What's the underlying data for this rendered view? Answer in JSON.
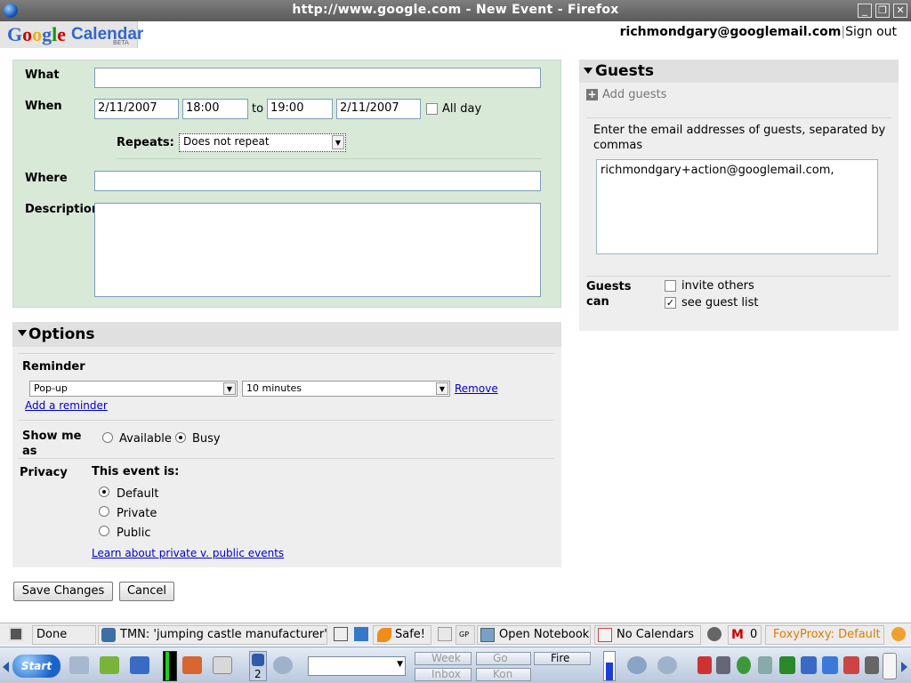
{
  "window": {
    "title": "http://www.google.com - New Event - Firefox"
  },
  "header": {
    "logo_google": "Google",
    "logo_calendar": "Calendar",
    "logo_beta": "BETA",
    "user_email": "richmondgary@googlemail.com",
    "separator": "|",
    "sign_out": "Sign out"
  },
  "event": {
    "what_label": "What",
    "what_value": "",
    "when_label": "When",
    "start_date": "2/11/2007",
    "start_time": "18:00",
    "to_label": "to",
    "end_time": "19:00",
    "end_date": "2/11/2007",
    "all_day_label": "All day",
    "repeats_label": "Repeats:",
    "repeats_value": "Does not repeat",
    "where_label": "Where",
    "where_value": "",
    "description_label": "Description",
    "description_value": ""
  },
  "options": {
    "title": "Options",
    "reminder_label": "Reminder",
    "reminder_type": "Pop-up",
    "reminder_time": "10 minutes",
    "remove_link": "Remove",
    "add_reminder_link": "Add a reminder",
    "show_me_as_label_1": "Show me",
    "show_me_as_label_2": "as",
    "available_label": "Available",
    "busy_label": "Busy",
    "privacy_label": "Privacy",
    "this_event_is": "This event is:",
    "privacy_default": "Default",
    "privacy_private": "Private",
    "privacy_public": "Public",
    "privacy_link": "Learn about private v. public events"
  },
  "guests": {
    "title": "Guests",
    "add_guests": "Add guests",
    "instructions": "Enter the email addresses of guests, separated by commas",
    "emails_value": "richmondgary+action@googlemail.com,",
    "guests_can_1": "Guests",
    "guests_can_2": "can",
    "invite_others": "invite others",
    "see_guest_list": "see guest list"
  },
  "buttons": {
    "save": "Save Changes",
    "cancel": "Cancel"
  },
  "statusbar": {
    "done": "Done",
    "tmn": "TMN: 'jumping castle manufacturer'",
    "safe": "Safe!",
    "gp": "GP",
    "open_notebook": "Open Notebook",
    "no_calendars": "No Calendars",
    "mail_count": "0",
    "foxyproxy": "FoxyProxy: Default"
  },
  "taskbar": {
    "start": "Start",
    "desktop_num": "2",
    "task_week": "Week",
    "task_go": "Go",
    "task_fire": "Fire",
    "task_inbox": "Inbox",
    "task_kon": "Kon"
  },
  "colors": {
    "event_panel": "#d8e9d8",
    "link": "#0000cc",
    "foxyproxy": "#e07b00"
  }
}
